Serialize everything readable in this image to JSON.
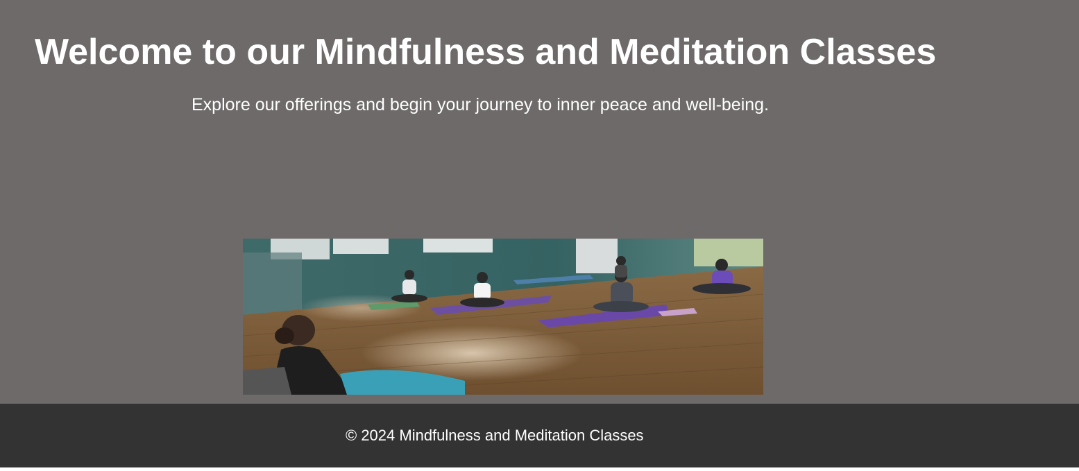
{
  "hero": {
    "title": "Welcome to our Mindfulness and Meditation Classes",
    "subtitle": "Explore our offerings and begin your journey to inner peace and well-being."
  },
  "image": {
    "alt": "Meditation class in a studio with people seated on yoga mats"
  },
  "footer": {
    "text": "© 2024 Mindfulness and Meditation Classes"
  },
  "colors": {
    "page_background": "#6d6a69",
    "footer_background": "#333333",
    "text": "#ffffff"
  }
}
